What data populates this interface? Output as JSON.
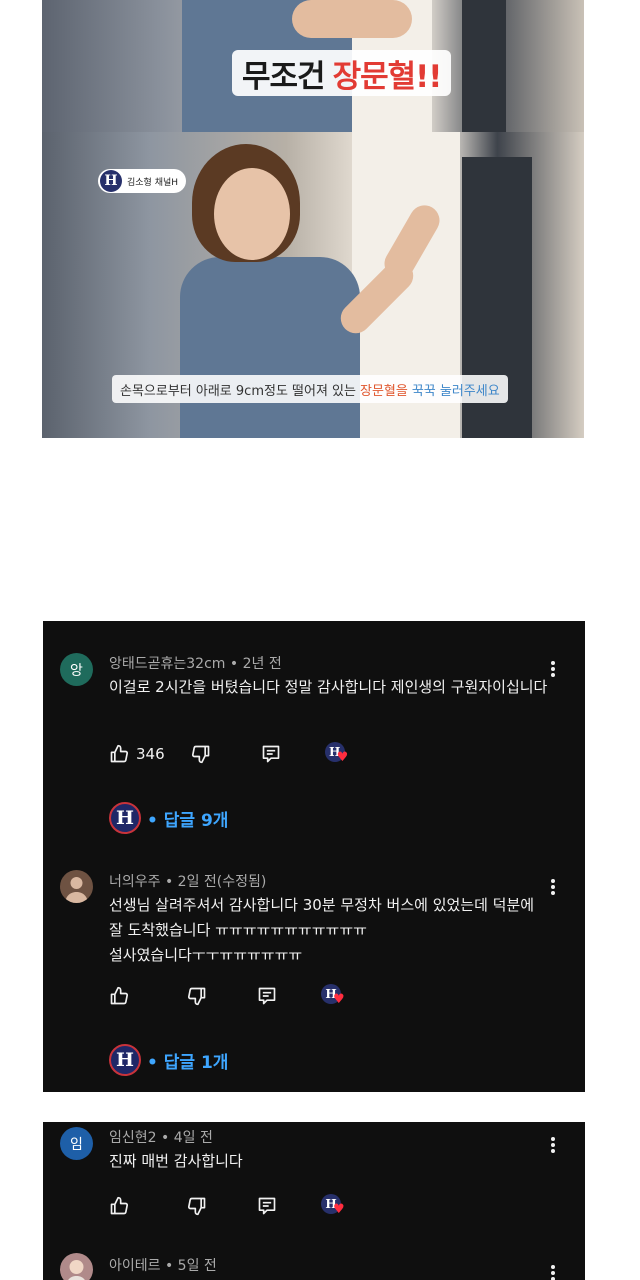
{
  "video": {
    "frame1": {
      "caption_word1": "무조건",
      "caption_word2": "장문혈!!"
    },
    "frame2": {
      "channel_name": "김소형 채널H",
      "channel_logo_letter": "H",
      "caption_part1": "손목으로부터 아래로 9cm정도 떨어져 있는",
      "caption_part2": "장문혈을",
      "caption_part3": "꾹꾹 눌러주세요"
    }
  },
  "comments": [
    {
      "avatar_letter": "앙",
      "avatar_color": "#1f6b5c",
      "meta": "앙태드곧휴는32cm • 2년 전",
      "text": "이걸로 2시간을 버텼습니다 정말 감사합니다 제인생의 구원자이십니다",
      "like_count": "346",
      "replies_label": "• 답글 9개"
    },
    {
      "avatar_letter": "",
      "avatar_color": "#7a5a48",
      "meta": "너의우주 • 2일 전(수정됨)",
      "text": "선생님 살려주셔서 감사합니다 30분 무정차 버스에 있었는데 덕분에 잘 도착했습니다 ㅠㅠㅠㅠㅠㅠㅠㅠㅠㅠㅠ 설사였습니다ㅜㅜㅠㅠㅠㅠㅠㅠ",
      "like_count": "",
      "replies_label": "• 답글 1개"
    },
    {
      "avatar_letter": "임",
      "avatar_color": "#1e5fa8",
      "meta": "임신현2 • 4일 전",
      "text": "진짜 매번 감사합니다",
      "like_count": ""
    },
    {
      "avatar_letter": "",
      "avatar_color": "#b08a8a",
      "meta": "아이테르 • 5일 전"
    }
  ],
  "icons": {
    "like": "thumbs-up-icon",
    "dislike": "thumbs-down-icon",
    "reply": "comment-reply-icon",
    "creator_heart": "creator-heart-icon",
    "more": "more-vert-icon",
    "heart_color": "#ff2d3f",
    "link_color": "#3ea6ff"
  }
}
